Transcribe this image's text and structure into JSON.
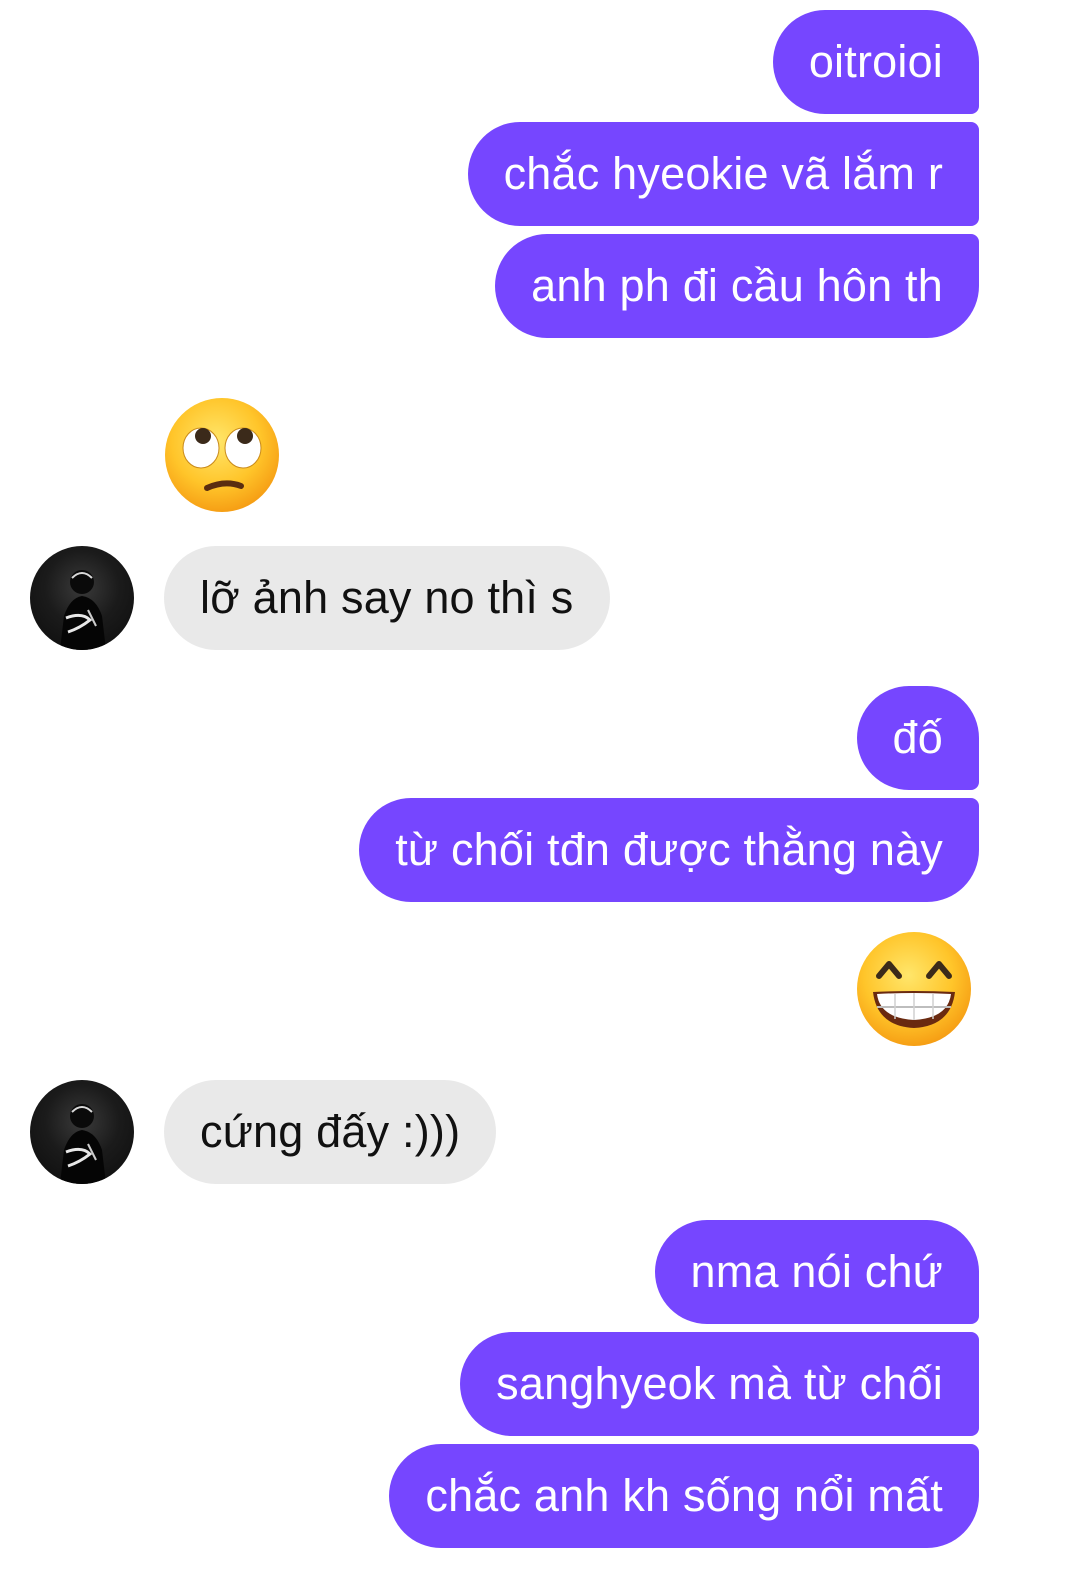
{
  "conversation": {
    "messages": [
      {
        "side": "out",
        "text": "oitroioi"
      },
      {
        "side": "out",
        "text": "chắc hyeokie vã lắm r"
      },
      {
        "side": "out",
        "text": "anh ph đi cầu hôn th"
      },
      {
        "side": "in",
        "emoji": "face-with-rolling-eyes"
      },
      {
        "side": "in",
        "text": "lỡ ảnh say no thì s"
      },
      {
        "side": "out",
        "text": "đố"
      },
      {
        "side": "out",
        "text": "từ chối tđn được thằng này"
      },
      {
        "side": "out",
        "emoji": "beaming-face-with-smiling-eyes"
      },
      {
        "side": "in",
        "text": "cứng đấy :)))"
      },
      {
        "side": "out",
        "text": "nma nói chứ"
      },
      {
        "side": "out",
        "text": "sanghyeok mà từ chối"
      },
      {
        "side": "out",
        "text": "chắc anh kh sống nổi mất"
      }
    ]
  },
  "colors": {
    "outgoing_bubble": "#7646ff",
    "incoming_bubble": "#e9e9e9",
    "background": "#ffffff"
  },
  "icons": {
    "avatar": "contact-avatar",
    "emoji_1": "face-with-rolling-eyes",
    "emoji_2": "beaming-face-with-smiling-eyes"
  }
}
